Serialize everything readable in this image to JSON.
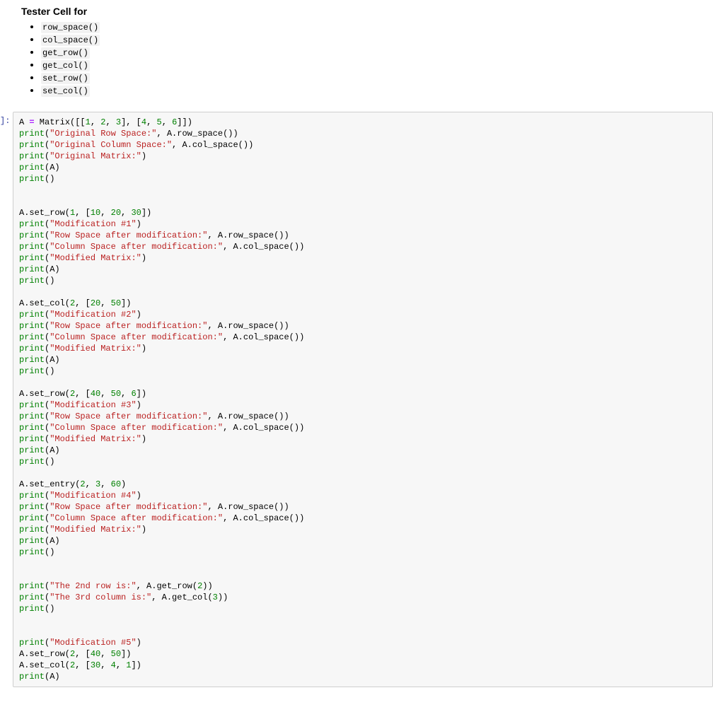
{
  "markdown": {
    "heading": "Tester Cell for",
    "functions": [
      "row_space()",
      "col_space()",
      "get_row()",
      "get_col()",
      "set_row()",
      "set_col()"
    ]
  },
  "prompt_label": "]:",
  "code_tokens": [
    [
      {
        "t": "name",
        "v": "A "
      },
      {
        "t": "op",
        "v": "="
      },
      {
        "t": "name",
        "v": " Matrix"
      },
      {
        "t": "pun",
        "v": "([["
      },
      {
        "t": "num",
        "v": "1"
      },
      {
        "t": "pun",
        "v": ", "
      },
      {
        "t": "num",
        "v": "2"
      },
      {
        "t": "pun",
        "v": ", "
      },
      {
        "t": "num",
        "v": "3"
      },
      {
        "t": "pun",
        "v": "], ["
      },
      {
        "t": "num",
        "v": "4"
      },
      {
        "t": "pun",
        "v": ", "
      },
      {
        "t": "num",
        "v": "5"
      },
      {
        "t": "pun",
        "v": ", "
      },
      {
        "t": "num",
        "v": "6"
      },
      {
        "t": "pun",
        "v": "]])"
      }
    ],
    [
      {
        "t": "call",
        "v": "print"
      },
      {
        "t": "pun",
        "v": "("
      },
      {
        "t": "str",
        "v": "\"Original Row Space:\""
      },
      {
        "t": "pun",
        "v": ", A.row_space())"
      }
    ],
    [
      {
        "t": "call",
        "v": "print"
      },
      {
        "t": "pun",
        "v": "("
      },
      {
        "t": "str",
        "v": "\"Original Column Space:\""
      },
      {
        "t": "pun",
        "v": ", A.col_space())"
      }
    ],
    [
      {
        "t": "call",
        "v": "print"
      },
      {
        "t": "pun",
        "v": "("
      },
      {
        "t": "str",
        "v": "\"Original Matrix:\""
      },
      {
        "t": "pun",
        "v": ")"
      }
    ],
    [
      {
        "t": "call",
        "v": "print"
      },
      {
        "t": "pun",
        "v": "(A)"
      }
    ],
    [
      {
        "t": "call",
        "v": "print"
      },
      {
        "t": "pun",
        "v": "()"
      }
    ],
    [],
    [],
    [
      {
        "t": "name",
        "v": "A.set_row("
      },
      {
        "t": "num",
        "v": "1"
      },
      {
        "t": "pun",
        "v": ", ["
      },
      {
        "t": "num",
        "v": "10"
      },
      {
        "t": "pun",
        "v": ", "
      },
      {
        "t": "num",
        "v": "20"
      },
      {
        "t": "pun",
        "v": ", "
      },
      {
        "t": "num",
        "v": "30"
      },
      {
        "t": "pun",
        "v": "])"
      }
    ],
    [
      {
        "t": "call",
        "v": "print"
      },
      {
        "t": "pun",
        "v": "("
      },
      {
        "t": "str",
        "v": "\"Modification #1\""
      },
      {
        "t": "pun",
        "v": ")"
      }
    ],
    [
      {
        "t": "call",
        "v": "print"
      },
      {
        "t": "pun",
        "v": "("
      },
      {
        "t": "str",
        "v": "\"Row Space after modification:\""
      },
      {
        "t": "pun",
        "v": ", A.row_space())"
      }
    ],
    [
      {
        "t": "call",
        "v": "print"
      },
      {
        "t": "pun",
        "v": "("
      },
      {
        "t": "str",
        "v": "\"Column Space after modification:\""
      },
      {
        "t": "pun",
        "v": ", A.col_space())"
      }
    ],
    [
      {
        "t": "call",
        "v": "print"
      },
      {
        "t": "pun",
        "v": "("
      },
      {
        "t": "str",
        "v": "\"Modified Matrix:\""
      },
      {
        "t": "pun",
        "v": ")"
      }
    ],
    [
      {
        "t": "call",
        "v": "print"
      },
      {
        "t": "pun",
        "v": "(A)"
      }
    ],
    [
      {
        "t": "call",
        "v": "print"
      },
      {
        "t": "pun",
        "v": "()"
      }
    ],
    [],
    [
      {
        "t": "name",
        "v": "A.set_col("
      },
      {
        "t": "num",
        "v": "2"
      },
      {
        "t": "pun",
        "v": ", ["
      },
      {
        "t": "num",
        "v": "20"
      },
      {
        "t": "pun",
        "v": ", "
      },
      {
        "t": "num",
        "v": "50"
      },
      {
        "t": "pun",
        "v": "])"
      }
    ],
    [
      {
        "t": "call",
        "v": "print"
      },
      {
        "t": "pun",
        "v": "("
      },
      {
        "t": "str",
        "v": "\"Modification #2\""
      },
      {
        "t": "pun",
        "v": ")"
      }
    ],
    [
      {
        "t": "call",
        "v": "print"
      },
      {
        "t": "pun",
        "v": "("
      },
      {
        "t": "str",
        "v": "\"Row Space after modification:\""
      },
      {
        "t": "pun",
        "v": ", A.row_space())"
      }
    ],
    [
      {
        "t": "call",
        "v": "print"
      },
      {
        "t": "pun",
        "v": "("
      },
      {
        "t": "str",
        "v": "\"Column Space after modification:\""
      },
      {
        "t": "pun",
        "v": ", A.col_space())"
      }
    ],
    [
      {
        "t": "call",
        "v": "print"
      },
      {
        "t": "pun",
        "v": "("
      },
      {
        "t": "str",
        "v": "\"Modified Matrix:\""
      },
      {
        "t": "pun",
        "v": ")"
      }
    ],
    [
      {
        "t": "call",
        "v": "print"
      },
      {
        "t": "pun",
        "v": "(A)"
      }
    ],
    [
      {
        "t": "call",
        "v": "print"
      },
      {
        "t": "pun",
        "v": "()"
      }
    ],
    [],
    [
      {
        "t": "name",
        "v": "A.set_row("
      },
      {
        "t": "num",
        "v": "2"
      },
      {
        "t": "pun",
        "v": ", ["
      },
      {
        "t": "num",
        "v": "40"
      },
      {
        "t": "pun",
        "v": ", "
      },
      {
        "t": "num",
        "v": "50"
      },
      {
        "t": "pun",
        "v": ", "
      },
      {
        "t": "num",
        "v": "6"
      },
      {
        "t": "pun",
        "v": "])"
      }
    ],
    [
      {
        "t": "call",
        "v": "print"
      },
      {
        "t": "pun",
        "v": "("
      },
      {
        "t": "str",
        "v": "\"Modification #3\""
      },
      {
        "t": "pun",
        "v": ")"
      }
    ],
    [
      {
        "t": "call",
        "v": "print"
      },
      {
        "t": "pun",
        "v": "("
      },
      {
        "t": "str",
        "v": "\"Row Space after modification:\""
      },
      {
        "t": "pun",
        "v": ", A.row_space())"
      }
    ],
    [
      {
        "t": "call",
        "v": "print"
      },
      {
        "t": "pun",
        "v": "("
      },
      {
        "t": "str",
        "v": "\"Column Space after modification:\""
      },
      {
        "t": "pun",
        "v": ", A.col_space())"
      }
    ],
    [
      {
        "t": "call",
        "v": "print"
      },
      {
        "t": "pun",
        "v": "("
      },
      {
        "t": "str",
        "v": "\"Modified Matrix:\""
      },
      {
        "t": "pun",
        "v": ")"
      }
    ],
    [
      {
        "t": "call",
        "v": "print"
      },
      {
        "t": "pun",
        "v": "(A)"
      }
    ],
    [
      {
        "t": "call",
        "v": "print"
      },
      {
        "t": "pun",
        "v": "()"
      }
    ],
    [],
    [
      {
        "t": "name",
        "v": "A.set_entry("
      },
      {
        "t": "num",
        "v": "2"
      },
      {
        "t": "pun",
        "v": ", "
      },
      {
        "t": "num",
        "v": "3"
      },
      {
        "t": "pun",
        "v": ", "
      },
      {
        "t": "num",
        "v": "60"
      },
      {
        "t": "pun",
        "v": ")"
      }
    ],
    [
      {
        "t": "call",
        "v": "print"
      },
      {
        "t": "pun",
        "v": "("
      },
      {
        "t": "str",
        "v": "\"Modification #4\""
      },
      {
        "t": "pun",
        "v": ")"
      }
    ],
    [
      {
        "t": "call",
        "v": "print"
      },
      {
        "t": "pun",
        "v": "("
      },
      {
        "t": "str",
        "v": "\"Row Space after modification:\""
      },
      {
        "t": "pun",
        "v": ", A.row_space())"
      }
    ],
    [
      {
        "t": "call",
        "v": "print"
      },
      {
        "t": "pun",
        "v": "("
      },
      {
        "t": "str",
        "v": "\"Column Space after modification:\""
      },
      {
        "t": "pun",
        "v": ", A.col_space())"
      }
    ],
    [
      {
        "t": "call",
        "v": "print"
      },
      {
        "t": "pun",
        "v": "("
      },
      {
        "t": "str",
        "v": "\"Modified Matrix:\""
      },
      {
        "t": "pun",
        "v": ")"
      }
    ],
    [
      {
        "t": "call",
        "v": "print"
      },
      {
        "t": "pun",
        "v": "(A)"
      }
    ],
    [
      {
        "t": "call",
        "v": "print"
      },
      {
        "t": "pun",
        "v": "()"
      }
    ],
    [],
    [],
    [
      {
        "t": "call",
        "v": "print"
      },
      {
        "t": "pun",
        "v": "("
      },
      {
        "t": "str",
        "v": "\"The 2nd row is:\""
      },
      {
        "t": "pun",
        "v": ", A.get_row("
      },
      {
        "t": "num",
        "v": "2"
      },
      {
        "t": "pun",
        "v": "))"
      }
    ],
    [
      {
        "t": "call",
        "v": "print"
      },
      {
        "t": "pun",
        "v": "("
      },
      {
        "t": "str",
        "v": "\"The 3rd column is:\""
      },
      {
        "t": "pun",
        "v": ", A.get_col("
      },
      {
        "t": "num",
        "v": "3"
      },
      {
        "t": "pun",
        "v": "))"
      }
    ],
    [
      {
        "t": "call",
        "v": "print"
      },
      {
        "t": "pun",
        "v": "()"
      }
    ],
    [],
    [],
    [
      {
        "t": "call",
        "v": "print"
      },
      {
        "t": "pun",
        "v": "("
      },
      {
        "t": "str",
        "v": "\"Modification #5\""
      },
      {
        "t": "pun",
        "v": ")"
      }
    ],
    [
      {
        "t": "name",
        "v": "A.set_row("
      },
      {
        "t": "num",
        "v": "2"
      },
      {
        "t": "pun",
        "v": ", ["
      },
      {
        "t": "num",
        "v": "40"
      },
      {
        "t": "pun",
        "v": ", "
      },
      {
        "t": "num",
        "v": "50"
      },
      {
        "t": "pun",
        "v": "])"
      }
    ],
    [
      {
        "t": "name",
        "v": "A.set_col("
      },
      {
        "t": "num",
        "v": "2"
      },
      {
        "t": "pun",
        "v": ", ["
      },
      {
        "t": "num",
        "v": "30"
      },
      {
        "t": "pun",
        "v": ", "
      },
      {
        "t": "num",
        "v": "4"
      },
      {
        "t": "pun",
        "v": ", "
      },
      {
        "t": "num",
        "v": "1"
      },
      {
        "t": "pun",
        "v": "])"
      }
    ],
    [
      {
        "t": "call",
        "v": "print"
      },
      {
        "t": "pun",
        "v": "(A)"
      }
    ]
  ]
}
